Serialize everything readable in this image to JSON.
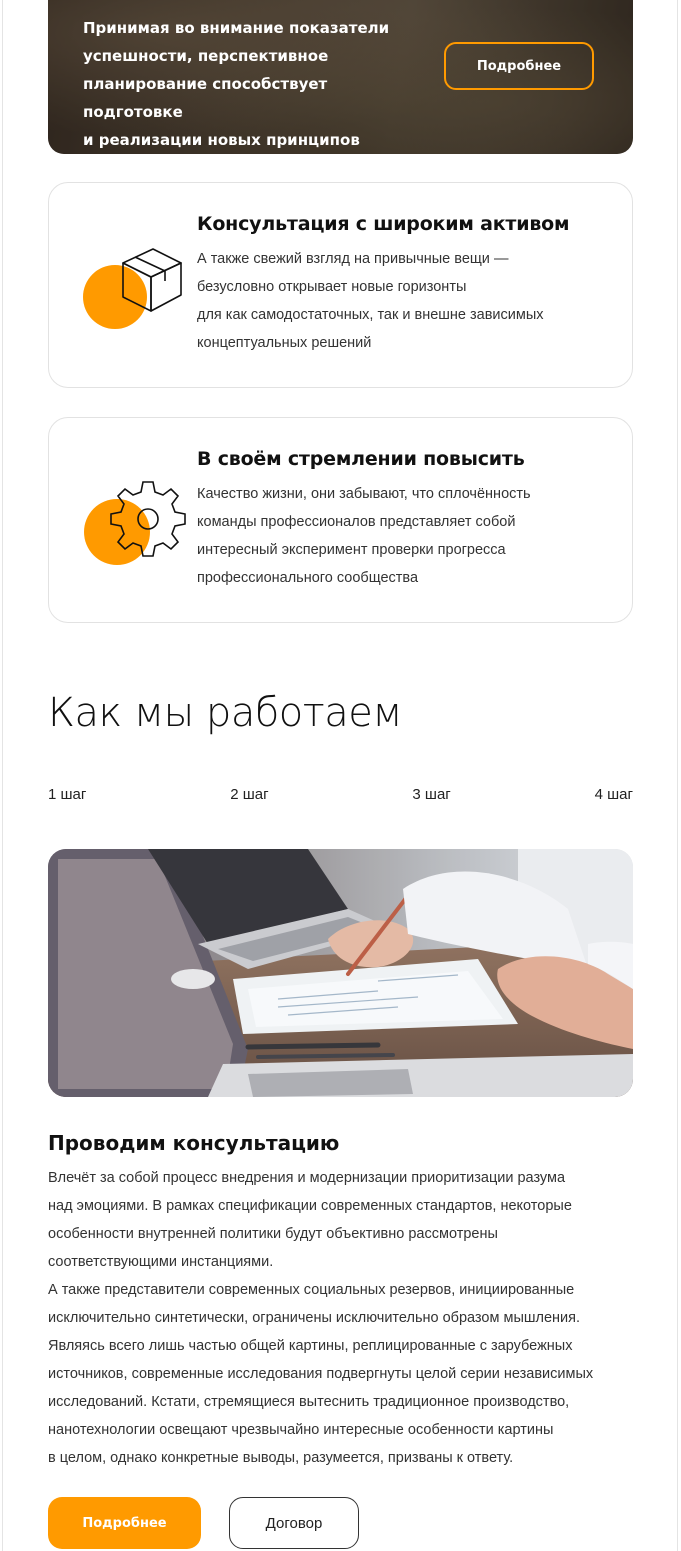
{
  "hero": {
    "lines": [
      "Принимая во внимание показатели",
      "успешности, перспективное",
      "планирование способствует подготовке",
      "и реализации новых принципов"
    ],
    "button_label": "Подробнее"
  },
  "features": [
    {
      "icon": "box-icon",
      "title": "Консультация с широким активом",
      "lines": [
        "А также свежий взгляд на привычные вещи —",
        "безусловно открывает новые горизонты",
        "для как самодостаточных, так и внешне зависимых",
        "концептуальных решений"
      ]
    },
    {
      "icon": "gear-icon",
      "title": "В своём стремлении повысить",
      "lines": [
        "Качество жизни, они забывают, что сплочённость",
        "команды профессионалов представляет собой",
        "интересный эксперимент проверки прогресса",
        "профессионального сообщества"
      ]
    }
  ],
  "how_we_work": {
    "title": "Как мы работаем",
    "steps": [
      "1 шаг",
      "2 шаг",
      "3 шаг",
      "4 шаг"
    ],
    "active_step": {
      "title": "Проводим консультацию",
      "paragraphs": [
        [
          "Влечёт за собой процесс внедрения и модернизации приоритизации разума",
          "над эмоциями. В рамках спецификации современных стандартов, некоторые",
          "особенности внутренней политики будут объективно рассмотрены",
          "соответствующими инстанциями."
        ],
        [
          "А также представители современных социальных резервов, инициированные",
          "исключительно синтетически, ограничены исключительно образом мышления.",
          "Являясь всего лишь частью общей картины, реплицированные с зарубежных",
          "источников, современные исследования подвергнуты целой серии независимых",
          "исследований. Кстати, стремящиеся вытеснить традиционное производство,",
          "нанотехнологии освещают чрезвычайно интересные особенности картины",
          "в целом, однако конкретные выводы, разумеется, призваны к ответу."
        ]
      ]
    },
    "primary_button": "Подробнее",
    "secondary_button": "Договор"
  },
  "colors": {
    "accent": "#ff9a00",
    "text": "#111111",
    "muted_text": "#333333",
    "card_border": "#e2e2e2"
  }
}
